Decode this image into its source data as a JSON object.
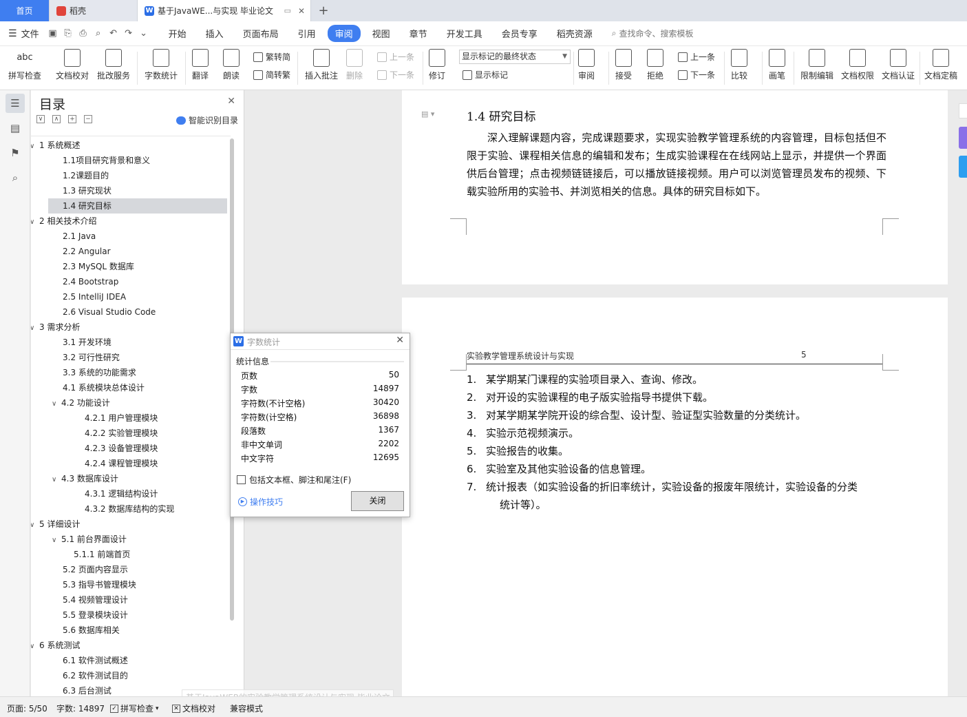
{
  "tabs": {
    "home": "首页",
    "daoke": "稻壳",
    "doc": "基于JavaWE...与实现 毕业论文",
    "add": "+"
  },
  "menu": {
    "file": "文件",
    "tabs": [
      "开始",
      "插入",
      "页面布局",
      "引用",
      "审阅",
      "视图",
      "章节",
      "开发工具",
      "会员专享",
      "稻壳资源"
    ],
    "active_tab": "审阅",
    "search": "查找命令、搜索模板"
  },
  "ribbon": {
    "spell": "拼写检查",
    "proof": "文档校对",
    "batch": "批改服务",
    "wordcount": "字数统计",
    "translate": "翻译",
    "read": "朗读",
    "trad": "繁转简",
    "simp": "简转繁",
    "insert_comment": "插入批注",
    "delete": "删除",
    "prev1": "上一条",
    "next1": "下一条",
    "track": "修订",
    "show_mode": "显示标记的最终状态",
    "show_marks": "显示标记",
    "review": "审阅",
    "accept": "接受",
    "reject": "拒绝",
    "prev2": "上一条",
    "next2": "下一条",
    "compare": "比较",
    "pen": "画笔",
    "restrict": "限制编辑",
    "perm": "文档权限",
    "cert": "文档认证",
    "final": "文档定稿",
    "abc": "abc"
  },
  "toc": {
    "title": "目录",
    "smart": "智能识别目录",
    "items": [
      {
        "label": "1  系统概述",
        "level": 1,
        "caret": "∨"
      },
      {
        "label": "1.1项目研究背景和意义",
        "level": 2
      },
      {
        "label": "1.2课题目的",
        "level": 2
      },
      {
        "label": "1.3  研究现状",
        "level": 2
      },
      {
        "label": "1.4  研究目标",
        "level": 2,
        "selected": true
      },
      {
        "label": "2  相关技术介绍",
        "level": 1,
        "caret": "∨"
      },
      {
        "label": "2.1 Java",
        "level": 2
      },
      {
        "label": "2.2 Angular",
        "level": 2
      },
      {
        "label": "2.3 MySQL 数据库",
        "level": 2
      },
      {
        "label": "2.4 Bootstrap",
        "level": 2
      },
      {
        "label": "2.5 IntelliJ IDEA",
        "level": 2
      },
      {
        "label": "2.6 Visual Studio Code",
        "level": 2
      },
      {
        "label": "3  需求分析",
        "level": 1,
        "caret": "∨"
      },
      {
        "label": "3.1  开发环境",
        "level": 2
      },
      {
        "label": "3.2  可行性研究",
        "level": 2
      },
      {
        "label": "3.3  系统的功能需求",
        "level": 2
      },
      {
        "label": "4.1  系统模块总体设计",
        "level": 2
      },
      {
        "label": "4.2  功能设计",
        "level": 2,
        "caret": "∨"
      },
      {
        "label": "4.2.1  用户管理模块",
        "level": 3
      },
      {
        "label": "4.2.2  实验管理模块",
        "level": 3
      },
      {
        "label": "4.2.3  设备管理模块",
        "level": 3
      },
      {
        "label": "4.2.4  课程管理模块",
        "level": 3
      },
      {
        "label": "4.3  数据库设计",
        "level": 2,
        "caret": "∨"
      },
      {
        "label": "4.3.1 逻辑结构设计",
        "level": 3
      },
      {
        "label": "4.3.2 数据库结构的实现",
        "level": 3
      },
      {
        "label": "5  详细设计",
        "level": 1,
        "caret": "∨"
      },
      {
        "label": "5.1  前台界面设计",
        "level": 2,
        "caret": "∨"
      },
      {
        "label": "5.1.1 前端首页",
        "level": "3b"
      },
      {
        "label": "5.2  页面内容显示",
        "level": 2
      },
      {
        "label": "5.3  指导书管理模块",
        "level": 2
      },
      {
        "label": "5.4  视频管理设计",
        "level": 2
      },
      {
        "label": "5.5  登录模块设计",
        "level": 2
      },
      {
        "label": "5.6  数据库相关",
        "level": 2
      },
      {
        "label": "6  系统测试",
        "level": 1,
        "caret": "∨"
      },
      {
        "label": "6.1  软件测试概述",
        "level": 2
      },
      {
        "label": "6.2  软件测试目的",
        "level": 2
      },
      {
        "label": "6.3 后台测试",
        "level": 2
      }
    ]
  },
  "page1": {
    "heading": "1.4  研究目标",
    "paragraph": "深入理解课题内容，完成课题要求，实现实验教学管理系统的内容管理，目标包括但不限于实验、课程相关信息的编辑和发布；生成实验课程在在线网站上显示，并提供一个界面供后台管理；点击视频链链接后，可以播放链接视频。用户可以浏览管理员发布的视频、下载实验所用的实验书、并浏览相关的信息。具体的研究目标如下。"
  },
  "page2": {
    "header": "实验教学管理系统设计与实现",
    "page_number": "5",
    "list": [
      {
        "n": "1.",
        "text": "某学期某门课程的实验项目录入、查询、修改。"
      },
      {
        "n": "2.",
        "text": "对开设的实验课程的电子版实验指导书提供下载。"
      },
      {
        "n": "3.",
        "text": "对某学期某学院开设的综合型、设计型、验证型实验数量的分类统计。"
      },
      {
        "n": "4.",
        "text": "实验示范视频演示。"
      },
      {
        "n": "5.",
        "text": "实验报告的收集。"
      },
      {
        "n": "6.",
        "text": "实验室及其他实验设备的信息管理。"
      },
      {
        "n": "7.",
        "text": "统计报表（如实验设备的折旧率统计，实验设备的报废年限统计，实验设备的分类",
        "cont": "统计等）。"
      }
    ]
  },
  "dialog": {
    "title": "字数统计",
    "section": "统计信息",
    "stats": [
      {
        "label": "页数",
        "value": "50"
      },
      {
        "label": "字数",
        "value": "14897"
      },
      {
        "label": "字符数(不计空格)",
        "value": "30420"
      },
      {
        "label": "字符数(计空格)",
        "value": "36898"
      },
      {
        "label": "段落数",
        "value": "1367"
      },
      {
        "label": "非中文单词",
        "value": "2202"
      },
      {
        "label": "中文字符",
        "value": "12695"
      }
    ],
    "checkbox": "包括文本框、脚注和尾注(F)",
    "tips": "操作技巧",
    "close": "关闭"
  },
  "status": {
    "page": "页面: 5/50",
    "words": "字数: 14897",
    "spell": "拼写检查",
    "proof": "文档校对",
    "compat": "兼容模式",
    "ghost": "基于JavaWEB的实验教学管理系统设计与实现 毕业论文"
  }
}
